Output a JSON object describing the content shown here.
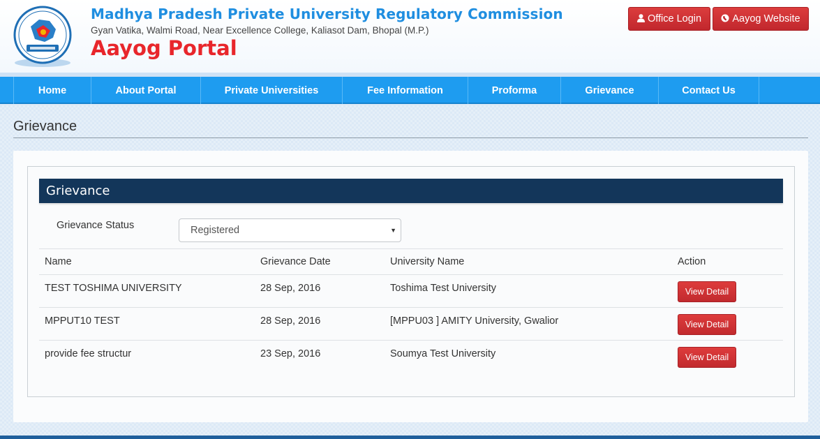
{
  "header": {
    "title": "Madhya Pradesh Private University Regulatory Commission",
    "address": "Gyan Vatika, Walmi Road, Near Excellence College, Kaliasot Dam, Bhopal (M.P.)",
    "portal": "Aayog Portal",
    "logo_icon": "commission-seal-logo",
    "office_login": "Office Login",
    "aayog_website": "Aayog Website"
  },
  "nav": {
    "items": [
      "Home",
      "About Portal",
      "Private Universities",
      "Fee Information",
      "Proforma",
      "Grievance",
      "Contact Us"
    ]
  },
  "page": {
    "heading": "Grievance",
    "panel_title": "Grievance",
    "status_label": "Grievance Status",
    "status_value": "Registered"
  },
  "table": {
    "headers": [
      "Name",
      "Grievance Date",
      "University Name",
      "Action"
    ],
    "rows": [
      {
        "name": "TEST TOSHIMA UNIVERSITY",
        "date": "28 Sep, 2016",
        "university": "Toshima Test University",
        "action": "View Detail"
      },
      {
        "name": "MPPUT10 TEST",
        "date": "28 Sep, 2016",
        "university": "[MPPU03 ] AMITY University, Gwalior",
        "action": "View Detail"
      },
      {
        "name": "provide fee structur",
        "date": "23 Sep, 2016",
        "university": "Soumya Test University",
        "action": "View Detail"
      }
    ]
  },
  "colors": {
    "brand_blue": "#1f8ee0",
    "nav_blue": "#1e9cf0",
    "portal_red": "#e8262b",
    "panel_navy": "#13365a",
    "button_red": "#c22a2e"
  }
}
